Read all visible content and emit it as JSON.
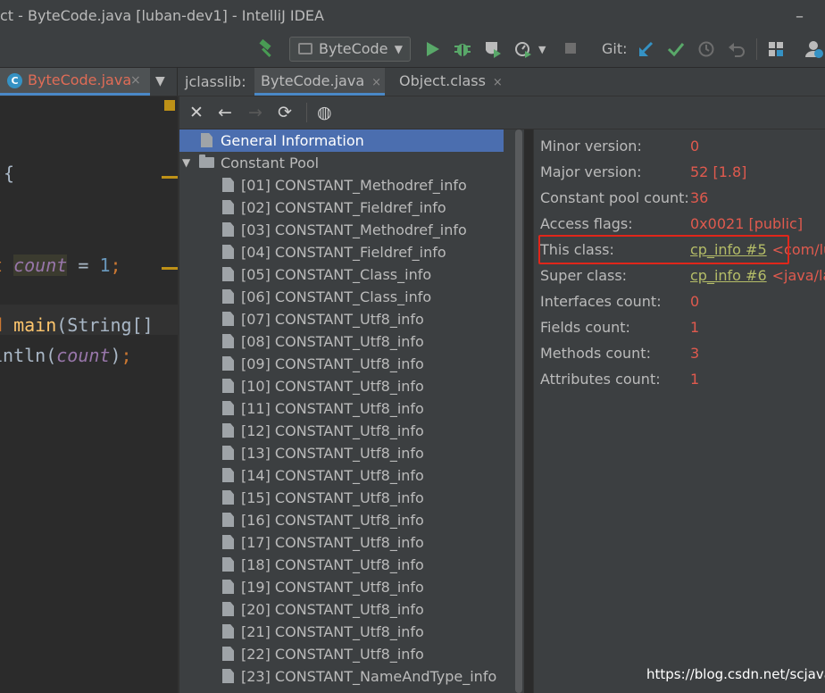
{
  "window": {
    "title": "ct - ByteCode.java [luban-dev1] - IntelliJ IDEA",
    "minimize_glyph": "–"
  },
  "toolbar": {
    "run_config": "ByteCode",
    "git_label": "Git:",
    "icons": [
      "hammer-icon",
      "run-icon",
      "debug-icon",
      "coverage-icon",
      "profile-icon",
      "stop-icon",
      "git-update-icon",
      "git-commit-icon",
      "history-icon",
      "rollback-icon",
      "project-structure-icon",
      "user-icon"
    ],
    "colors": {
      "build": "#499c54",
      "run": "#59a869",
      "update": "#3592c4",
      "commit": "#59a869",
      "muted": "#6e6e6e"
    }
  },
  "tabs": {
    "editor_tab": {
      "label": "ByteCode.java",
      "close": "×",
      "icon_letter": "C"
    },
    "dropdown": "⌄",
    "jclasslib_label": "jclasslib:",
    "jc_tabs": [
      {
        "label": "ByteCode.java",
        "close": "×",
        "active": true
      },
      {
        "label": "Object.class",
        "close": "×",
        "active": false
      }
    ]
  },
  "editor": {
    "lines": [
      [
        {
          "text": "{",
          "color": "#a9b7c6"
        }
      ],
      [
        {
          "text": "t ",
          "color": "#cc7832"
        },
        {
          "text": "count",
          "color": "#9876aa",
          "italic": true,
          "bg": "#3b3b2f"
        },
        {
          "text": " = ",
          "color": "#a9b7c6"
        },
        {
          "text": "1",
          "color": "#6897bb"
        },
        {
          "text": ";",
          "color": "#cc7832"
        }
      ],
      [
        {
          "text": "d ",
          "color": "#cc7832"
        },
        {
          "text": "main",
          "color": "#ffc66d"
        },
        {
          "text": "(String[] ",
          "color": "#a9b7c6"
        }
      ],
      [
        {
          "text": "intln(",
          "color": "#a9b7c6"
        },
        {
          "text": "count",
          "color": "#9876aa",
          "italic": true
        },
        {
          "text": ")",
          "color": "#a9b7c6"
        },
        {
          "text": ";",
          "color": "#cc7832"
        }
      ]
    ]
  },
  "jclasslib_toolbar": {
    "close": "✕",
    "back": "←",
    "forward": "→",
    "refresh": "⟳",
    "browser": "◍"
  },
  "tree": {
    "general": "General Information",
    "constant_pool": "Constant Pool",
    "caret": "▼",
    "entries": [
      "[01] CONSTANT_Methodref_info",
      "[02] CONSTANT_Fieldref_info",
      "[03] CONSTANT_Methodref_info",
      "[04] CONSTANT_Fieldref_info",
      "[05] CONSTANT_Class_info",
      "[06] CONSTANT_Class_info",
      "[07] CONSTANT_Utf8_info",
      "[08] CONSTANT_Utf8_info",
      "[09] CONSTANT_Utf8_info",
      "[10] CONSTANT_Utf8_info",
      "[11] CONSTANT_Utf8_info",
      "[12] CONSTANT_Utf8_info",
      "[13] CONSTANT_Utf8_info",
      "[14] CONSTANT_Utf8_info",
      "[15] CONSTANT_Utf8_info",
      "[16] CONSTANT_Utf8_info",
      "[17] CONSTANT_Utf8_info",
      "[18] CONSTANT_Utf8_info",
      "[19] CONSTANT_Utf8_info",
      "[20] CONSTANT_Utf8_info",
      "[21] CONSTANT_Utf8_info",
      "[22] CONSTANT_Utf8_info",
      "[23] CONSTANT_NameAndType_info"
    ]
  },
  "info": {
    "rows": [
      {
        "key": "Minor version:",
        "value": "0"
      },
      {
        "key": "Major version:",
        "value": "52 [1.8]"
      },
      {
        "key": "Constant pool count:",
        "value": "36"
      },
      {
        "key": "Access flags:",
        "value": "0x0021 [public]"
      },
      {
        "key": "This class:",
        "link": "cp_info #5",
        "extra": "<com/lu"
      },
      {
        "key": "Super class:",
        "link": "cp_info #6",
        "extra": "<java/lan"
      },
      {
        "key": "Interfaces count:",
        "value": "0"
      },
      {
        "key": "Fields count:",
        "value": "1"
      },
      {
        "key": "Methods count:",
        "value": "3"
      },
      {
        "key": "Attributes count:",
        "value": "1"
      }
    ]
  },
  "watermark": "https://blog.csdn.net/scjava"
}
